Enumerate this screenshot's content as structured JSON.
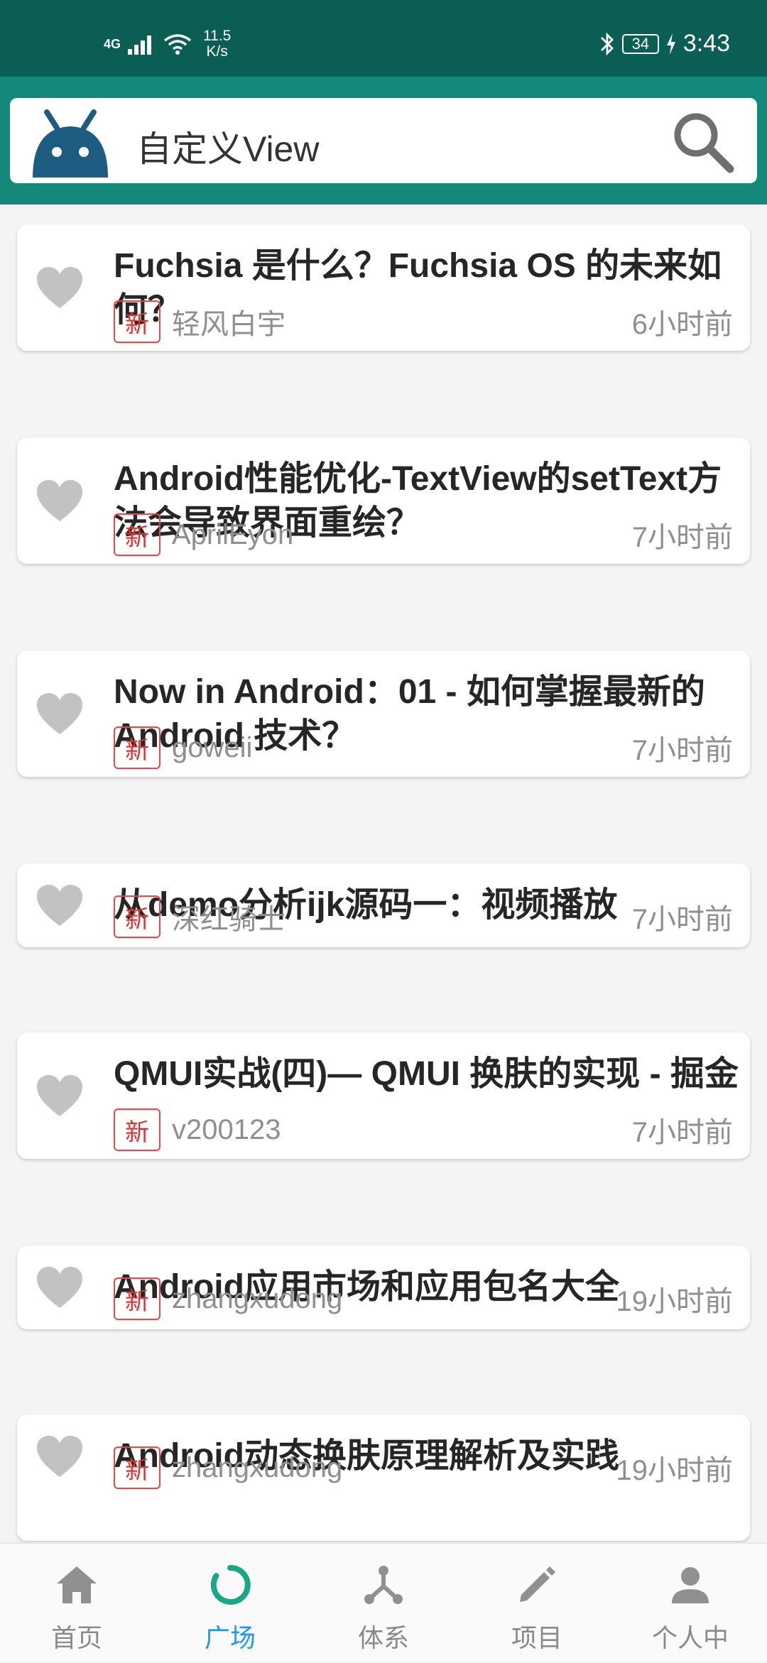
{
  "status_bar": {
    "network": "4G",
    "speed_value": "11.5",
    "speed_unit": "K/s",
    "battery": "34",
    "time": "3:43"
  },
  "search": {
    "title": "自定义View"
  },
  "articles": [
    {
      "title": "Fuchsia 是什么？Fuchsia OS 的未来如何？",
      "badge": "新",
      "author": "轻风白宇",
      "time": "6小时前",
      "favorite": false
    },
    {
      "title": "Android性能优化-TextView的setText方法会导致界面重绘？",
      "badge": "新",
      "author": "AprilEyon",
      "time": "7小时前",
      "favorite": false
    },
    {
      "title": "Now in Android：01 - 如何掌握最新的 Android 技术？",
      "badge": "新",
      "author": "goweii",
      "time": "7小时前",
      "favorite": false
    },
    {
      "title": "从demo分析ijk源码一：视频播放",
      "badge": "新",
      "author": "深红骑士",
      "time": "7小时前",
      "favorite": false
    },
    {
      "title": "QMUI实战(四)— QMUI 换肤的实现 - 掘金",
      "badge": "新",
      "author": "v200123",
      "time": "7小时前",
      "favorite": false
    },
    {
      "title": "Android应用市场和应用包名大全",
      "badge": "新",
      "author": "zhangxudong",
      "time": "19小时前",
      "favorite": false
    },
    {
      "title": "Android动态换肤原理解析及实践",
      "badge": "新",
      "author": "zhangxudong",
      "time": "19小时前",
      "favorite": false
    }
  ],
  "bottom_nav": [
    {
      "label": "首页",
      "icon": "home-icon",
      "active": false
    },
    {
      "label": "广场",
      "icon": "square-icon",
      "active": true
    },
    {
      "label": "体系",
      "icon": "hierarchy-icon",
      "active": false
    },
    {
      "label": "项目",
      "icon": "pencil-icon",
      "active": false
    },
    {
      "label": "个人中",
      "icon": "person-icon",
      "active": false
    }
  ],
  "colors": {
    "status_bar": "#0b5e53",
    "app_bar": "#14897a",
    "accent": "#2196f3",
    "badge_red": "#e04a4a",
    "heart_gray": "#c2c2c2"
  }
}
